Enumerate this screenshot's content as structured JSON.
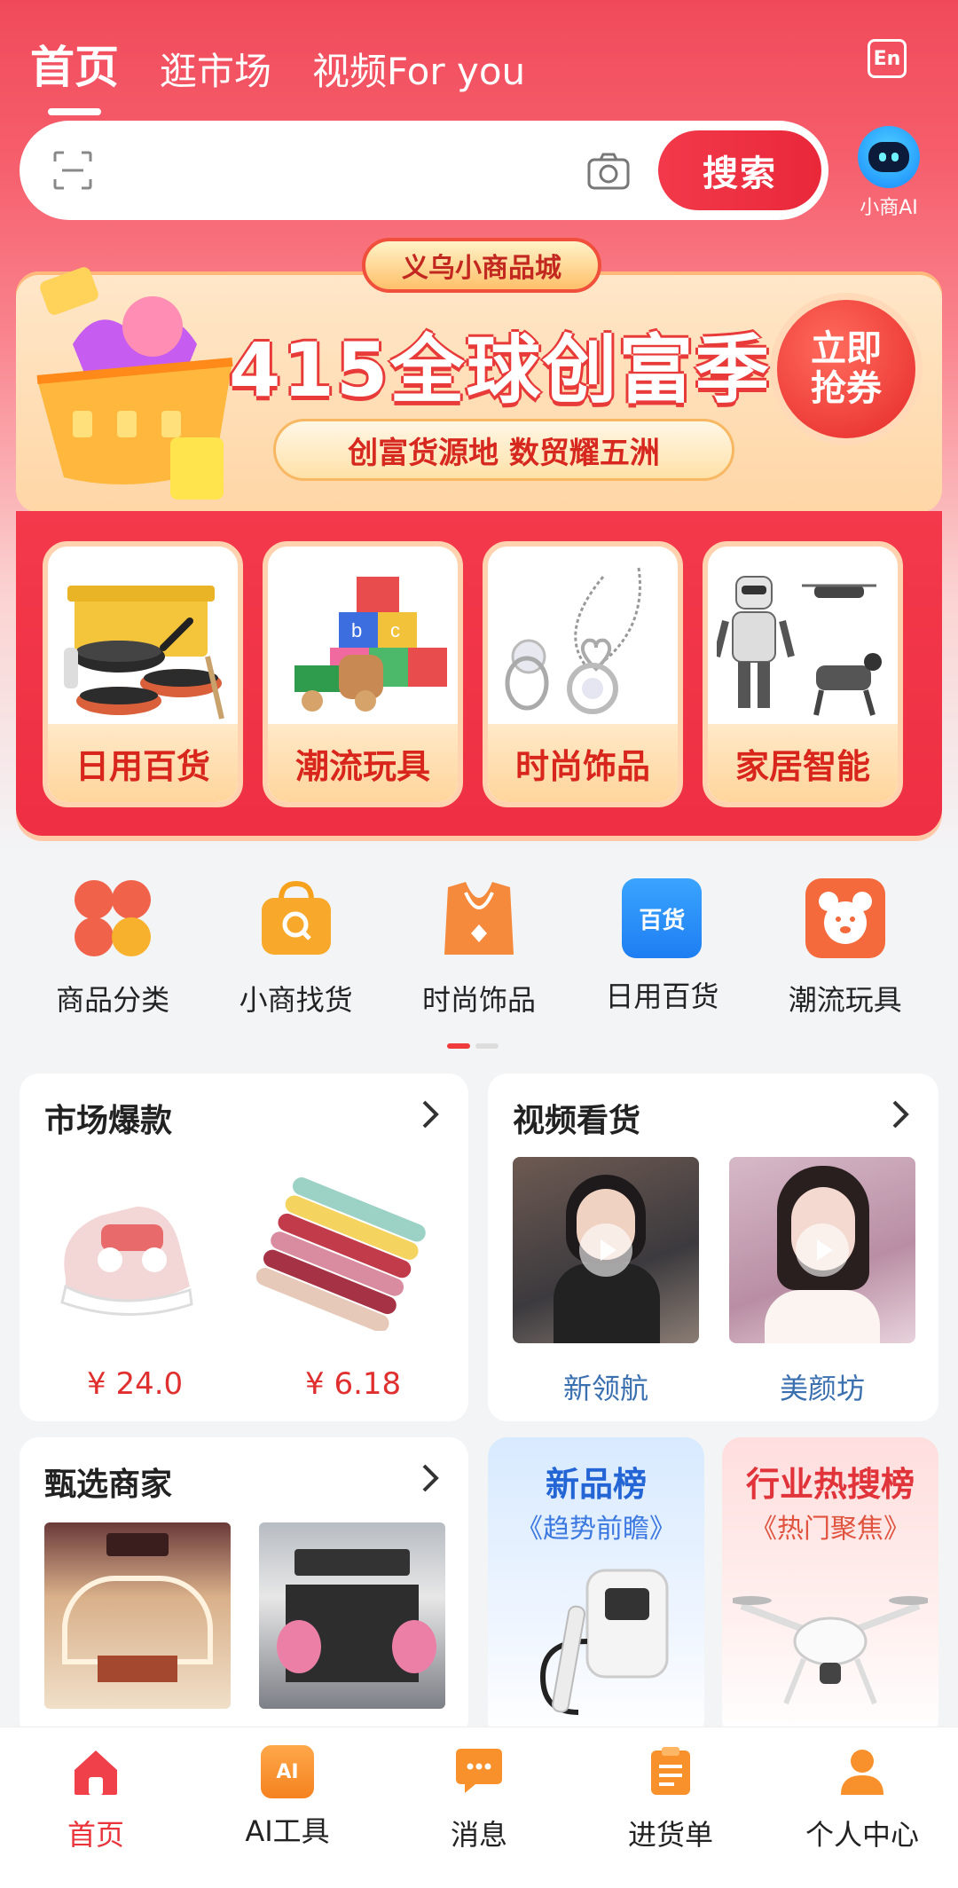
{
  "top_tabs": [
    "首页",
    "逛市场",
    "视频For you"
  ],
  "lang_button": "En",
  "search": {
    "placeholder": "",
    "button": "搜索"
  },
  "ai_entry": {
    "label": "小商AI"
  },
  "promo": {
    "badge": "义乌小商品城",
    "title": "415全球创富季",
    "subtitle": "创富货源地 数贸耀五洲",
    "cta": "立即抢券"
  },
  "categories": [
    {
      "label": "日用百货",
      "icon": "cookware-image"
    },
    {
      "label": "潮流玩具",
      "icon": "toy-blocks-image"
    },
    {
      "label": "时尚饰品",
      "icon": "necklace-image"
    },
    {
      "label": "家居智能",
      "icon": "robot-drone-image"
    }
  ],
  "quick_nav": [
    {
      "label": "商品分类",
      "icon": "category-grid-icon"
    },
    {
      "label": "小商找货",
      "icon": "bag-search-icon"
    },
    {
      "label": "时尚饰品",
      "icon": "necklace-icon"
    },
    {
      "label": "日用百货",
      "icon": "store-bag-icon",
      "icon_text": "百货"
    },
    {
      "label": "潮流玩具",
      "icon": "teddy-bear-icon"
    }
  ],
  "market_hot": {
    "title": "市场爆款",
    "items": [
      {
        "price": "¥ 24.0",
        "image": "baby-shoe-image"
      },
      {
        "price": "¥ 6.18",
        "image": "ribbon-rolls-image"
      }
    ]
  },
  "video_shop": {
    "title": "视频看货",
    "items": [
      {
        "name": "新领航"
      },
      {
        "name": "美颜坊"
      }
    ]
  },
  "selected_merchants": {
    "title": "甄选商家"
  },
  "new_ranking": {
    "title": "新品榜",
    "subtitle": "《趋势前瞻》"
  },
  "hot_search": {
    "title": "行业热搜榜",
    "subtitle": "《热门聚焦》"
  },
  "bottom_nav": [
    {
      "label": "首页",
      "icon": "home-icon",
      "active": true
    },
    {
      "label": "AI工具",
      "icon": "ai-toolbox-icon",
      "icon_text": "AI"
    },
    {
      "label": "消息",
      "icon": "message-icon"
    },
    {
      "label": "进货单",
      "icon": "order-list-icon"
    },
    {
      "label": "个人中心",
      "icon": "person-icon"
    }
  ],
  "colors": {
    "brand_red": "#ef2f43",
    "price_red": "#e02f2f",
    "link_blue": "#3a70b0",
    "nav_active": "#e8343a"
  }
}
